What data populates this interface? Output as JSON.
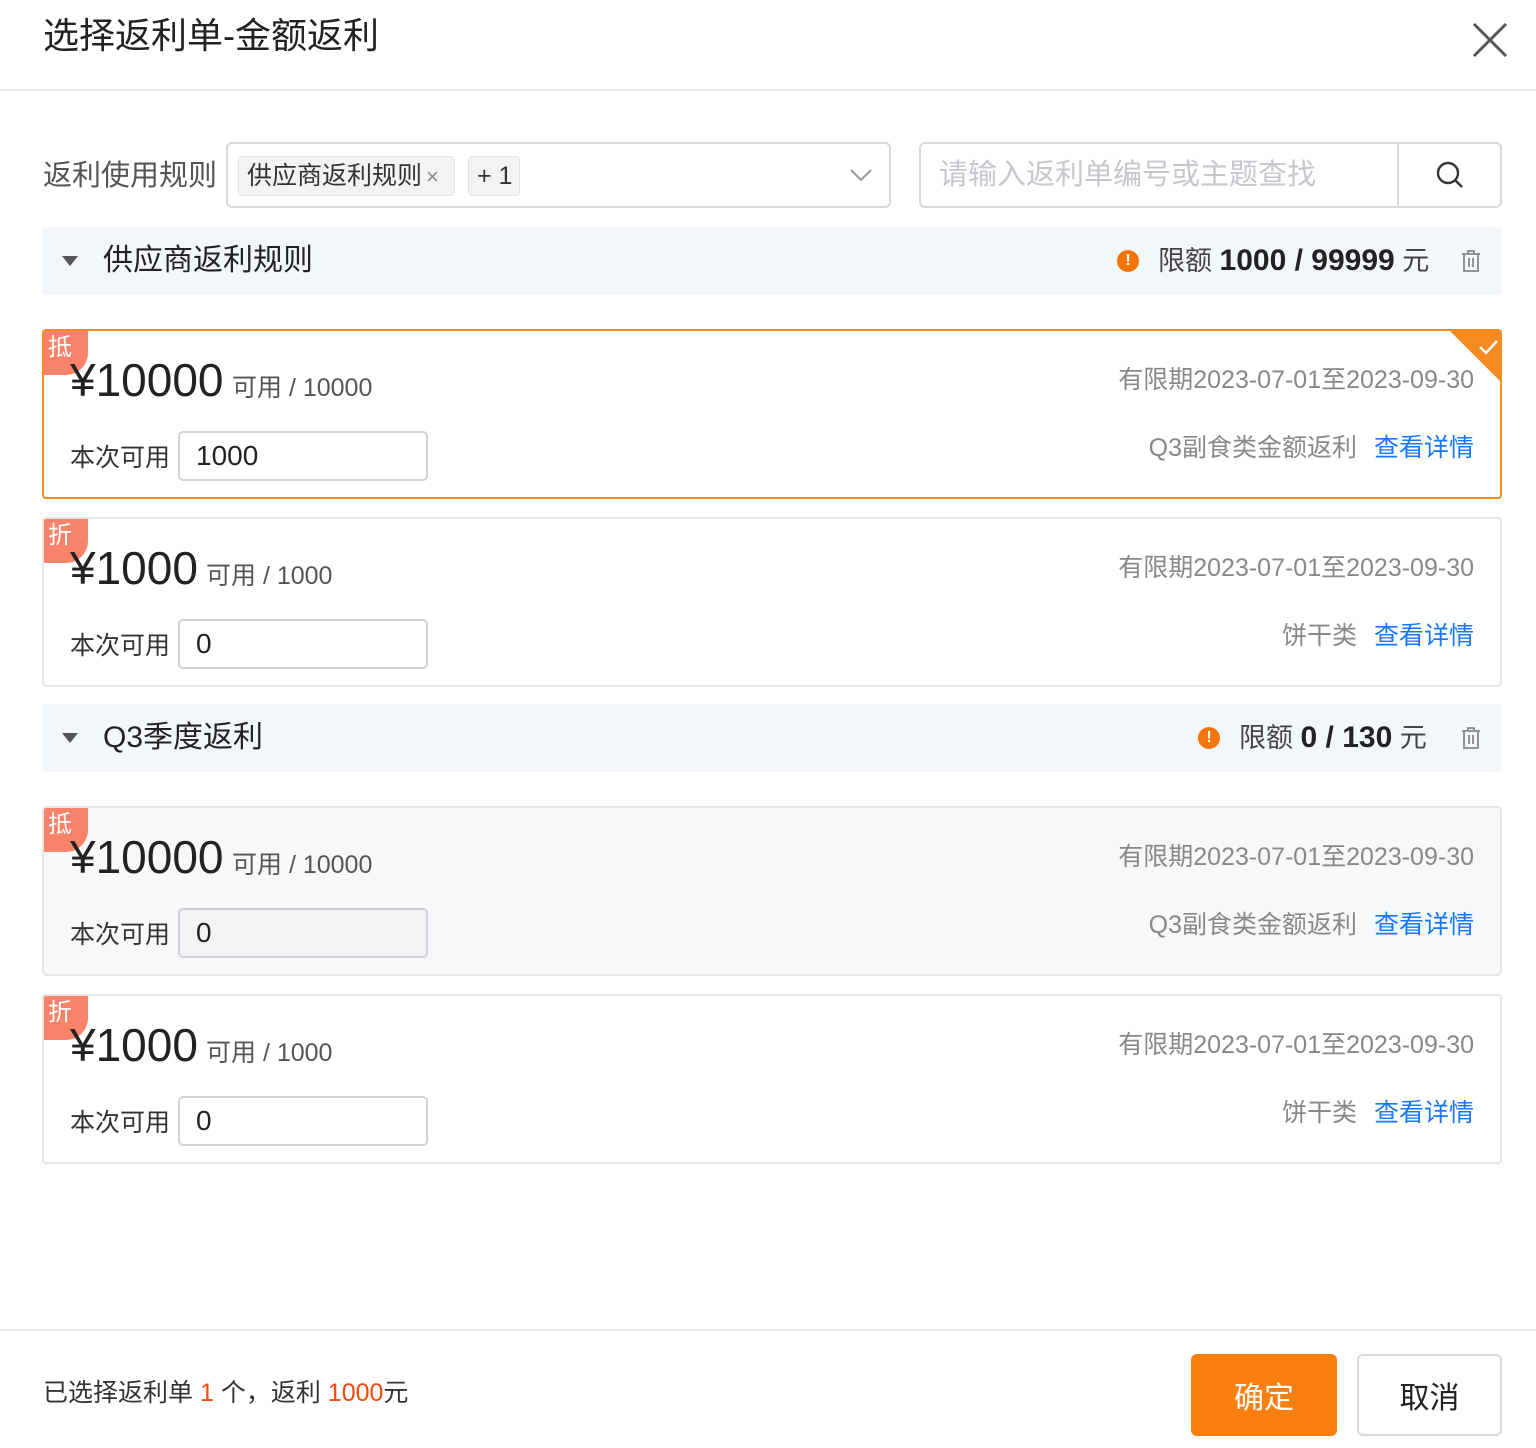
{
  "dialog": {
    "title": "选择返利单-金额返利",
    "close_icon": "close-icon"
  },
  "filter": {
    "label": "返利使用规则",
    "tags": [
      "供应商返利规则",
      "+ 1"
    ],
    "tag_remove": "×",
    "search_placeholder": "请输入返利单编号或主题查找",
    "search_icon": "search-icon"
  },
  "groups": [
    {
      "title": "供应商返利规则",
      "quota_label": "限额",
      "quota_value": "1000 / 99999",
      "quota_unit": "元",
      "cards": [
        {
          "badge": "抵",
          "amount": "¥10000",
          "avail": "可用 / 10000",
          "validity": "有限期2023-07-01至2023-09-30",
          "use_label": "本次可用",
          "use_value": "1000",
          "category": "Q3副食类金额返利",
          "detail": "查看详情",
          "selected": true,
          "disabled": false
        },
        {
          "badge": "折",
          "amount": "¥1000",
          "avail": "可用 / 1000",
          "validity": "有限期2023-07-01至2023-09-30",
          "use_label": "本次可用",
          "use_value": "0",
          "category": "饼干类",
          "detail": "查看详情",
          "selected": false,
          "disabled": false
        }
      ]
    },
    {
      "title": "Q3季度返利",
      "quota_label": "限额",
      "quota_value": "0 / 130",
      "quota_unit": "元",
      "cards": [
        {
          "badge": "抵",
          "amount": "¥10000",
          "avail": "可用 / 10000",
          "validity": "有限期2023-07-01至2023-09-30",
          "use_label": "本次可用",
          "use_value": "0",
          "category": "Q3副食类金额返利",
          "detail": "查看详情",
          "selected": false,
          "disabled": true
        },
        {
          "badge": "折",
          "amount": "¥1000",
          "avail": "可用 / 1000",
          "validity": "有限期2023-07-01至2023-09-30",
          "use_label": "本次可用",
          "use_value": "0",
          "category": "饼干类",
          "detail": "查看详情",
          "selected": false,
          "disabled": false
        }
      ]
    }
  ],
  "footer": {
    "summary_prefix": "已选择返利单",
    "selected_count": "1",
    "summary_mid": "个，返利",
    "rebate_amount": "1000",
    "summary_suffix": "元",
    "confirm": "确定",
    "cancel": "取消"
  },
  "colors": {
    "accent": "#fb7f0e",
    "link": "#1677ff",
    "highlight": "#f5490b",
    "badge": "#f9826a",
    "warning": "#f5750b"
  }
}
